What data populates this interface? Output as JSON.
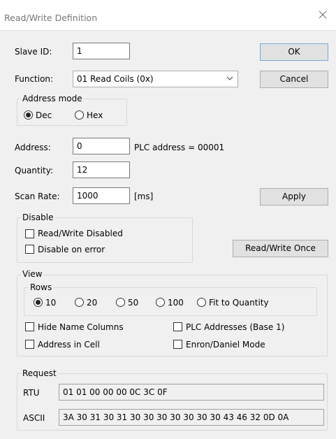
{
  "window": {
    "title": "Read/Write Definition",
    "close_icon": "close-icon"
  },
  "slave_id": {
    "label": "Slave ID:",
    "value": "1"
  },
  "buttons": {
    "ok": "OK",
    "cancel": "Cancel",
    "apply": "Apply",
    "rw_once": "Read/Write Once"
  },
  "function": {
    "label": "Function:",
    "selected": "01 Read Coils (0x)"
  },
  "address_mode": {
    "label": "Address mode",
    "options": [
      "Dec",
      "Hex"
    ],
    "selected": "Dec"
  },
  "address": {
    "label": "Address:",
    "value": "0",
    "plc_text": "PLC address = 00001"
  },
  "quantity": {
    "label": "Quantity:",
    "value": "12"
  },
  "scan_rate": {
    "label": "Scan Rate:",
    "value": "1000",
    "unit": "[ms]"
  },
  "disable": {
    "label": "Disable",
    "options": [
      "Read/Write Disabled",
      "Disable on error"
    ],
    "checked": [
      false,
      false
    ]
  },
  "view": {
    "label": "View",
    "rows_label": "Rows",
    "rows_options": [
      "10",
      "20",
      "50",
      "100",
      "Fit to Quantity"
    ],
    "rows_selected": "10",
    "checks": [
      "Hide Name Columns",
      "PLC Addresses (Base 1)",
      "Address in Cell",
      "Enron/Daniel Mode"
    ],
    "checked": [
      false,
      false,
      false,
      false
    ]
  },
  "request": {
    "label": "Request",
    "rtu_label": "RTU",
    "rtu_value": "01 01 00 00 00 0C 3C 0F",
    "ascii_label": "ASCII",
    "ascii_value": "3A 30 31 30 31 30 30 30 30 30 30 30 43 46 32 0D 0A"
  }
}
